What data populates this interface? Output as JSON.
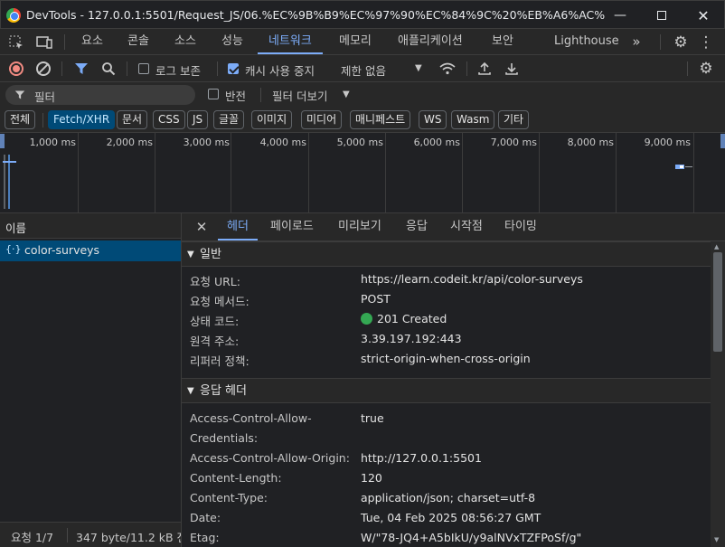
{
  "window": {
    "title": "DevTools - 127.0.0.1:5501/Request_JS/06.%EC%9B%B9%EC%97%90%EC%84%9C%20%EB%A6%AC%ED%80%98%EC..."
  },
  "tabs": [
    "요소",
    "콘솔",
    "소스",
    "성능",
    "네트워크",
    "메모리",
    "애플리케이션",
    "보안",
    "Lighthouse"
  ],
  "toolbar": {
    "preserve_log": "로그 보존",
    "disable_cache": "캐시 사용 중지",
    "throttle": "제한 없음"
  },
  "filter": {
    "placeholder": "필터",
    "invert": "반전",
    "more_filters": "필터 더보기"
  },
  "chips": [
    "전체",
    "Fetch/XHR",
    "문서",
    "CSS",
    "JS",
    "글꼴",
    "이미지",
    "미디어",
    "매니페스트",
    "WS",
    "Wasm",
    "기타"
  ],
  "timeline": {
    "ticks": [
      "1,000 ms",
      "2,000 ms",
      "3,000 ms",
      "4,000 ms",
      "5,000 ms",
      "6,000 ms",
      "7,000 ms",
      "8,000 ms",
      "9,000 ms"
    ]
  },
  "requests": {
    "header": "이름",
    "items": [
      {
        "name": "color-surveys"
      }
    ],
    "status": {
      "count": "요청 1/7",
      "size": "347 byte/11.2 kB 전"
    }
  },
  "detail": {
    "tabs": [
      "헤더",
      "페이로드",
      "미리보기",
      "응답",
      "시작점",
      "타이밍"
    ],
    "general": {
      "title": "일반",
      "rows": [
        {
          "key": "요청 URL:",
          "value": "https://learn.codeit.kr/api/color-surveys"
        },
        {
          "key": "요청 메서드:",
          "value": "POST"
        },
        {
          "key": "상태 코드:",
          "value": "201 Created"
        },
        {
          "key": "원격 주소:",
          "value": "3.39.197.192:443"
        },
        {
          "key": "리퍼러 정책:",
          "value": "strict-origin-when-cross-origin"
        }
      ]
    },
    "response_headers": {
      "title": "응답 헤더",
      "rows": [
        {
          "key": "Access-Control-Allow-",
          "key2": "Credentials:",
          "value": "true"
        },
        {
          "key": "Access-Control-Allow-Origin:",
          "value": "http://127.0.0.1:5501"
        },
        {
          "key": "Content-Length:",
          "value": "120"
        },
        {
          "key": "Content-Type:",
          "value": "application/json; charset=utf-8"
        },
        {
          "key": "Date:",
          "value": "Tue, 04 Feb 2025 08:56:27 GMT"
        },
        {
          "key": "Etag:",
          "value": "W/\"78-JQ4+A5bIkU/y9alNVxTZFPoSf/g\""
        }
      ]
    }
  },
  "colors": {
    "accent": "#7cacf8",
    "status_ok": "#34a853",
    "selected_row": "#004a77",
    "record": "#f28b82"
  }
}
